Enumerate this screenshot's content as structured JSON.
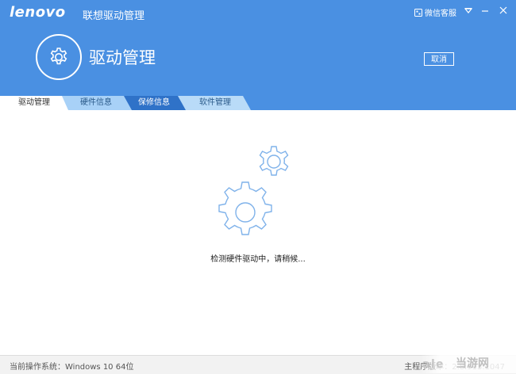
{
  "titlebar": {
    "logo": "lenovo",
    "app_title": "联想驱动管理",
    "wechat_label": "微信客服",
    "menu_icon": "triangle-down",
    "minimize_icon": "minus",
    "close_icon": "close"
  },
  "header": {
    "icon": "gear-icon",
    "page_title": "驱动管理",
    "cancel_label": "取消"
  },
  "tabs": [
    {
      "label": "驱动管理"
    },
    {
      "label": "硬件信息"
    },
    {
      "label": "保修信息"
    },
    {
      "label": "软件管理"
    }
  ],
  "main": {
    "status_text": "检测硬件驱动中，请稍候..."
  },
  "footer": {
    "os_text": "当前操作系统：Windows 10 64位",
    "version_text": "主程序版本：2.8.913.1047"
  },
  "watermark": {
    "text": "当游网"
  },
  "colors": {
    "header_bg": "#4a90e2",
    "tab_active": "#ffffff",
    "tab_hardware": "#a8d1f7",
    "tab_warranty": "#2f72c8",
    "tab_software": "#b9dbf8",
    "gear_stroke": "#7fb2ea"
  }
}
